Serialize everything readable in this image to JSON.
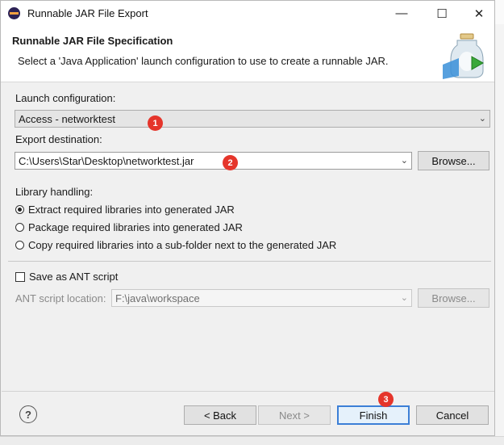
{
  "window": {
    "title": "Runnable JAR File Export",
    "controls": [
      "minimize-icon",
      "maximize-icon",
      "close-icon"
    ]
  },
  "header": {
    "title": "Runnable JAR File Specification",
    "description": "Select a 'Java Application' launch configuration to use to create a runnable JAR."
  },
  "launch": {
    "label": "Launch configuration:",
    "value": "Access - networktest",
    "badge": "1"
  },
  "export": {
    "label": "Export destination:",
    "value": "C:\\Users\\Star\\Desktop\\networktest.jar",
    "badge": "2",
    "browse_label": "Browse..."
  },
  "library": {
    "label": "Library handling:",
    "options": [
      {
        "label": "Extract required libraries into generated JAR",
        "selected": true
      },
      {
        "label": "Package required libraries into generated JAR",
        "selected": false
      },
      {
        "label": "Copy required libraries into a sub-folder next to the generated JAR",
        "selected": false
      }
    ]
  },
  "ant": {
    "checkbox_label": "Save as ANT script",
    "checked": false,
    "location_label": "ANT script location:",
    "location_value": "F:\\java\\workspace",
    "browse_label": "Browse..."
  },
  "footer": {
    "help": "?",
    "back_label": "< Back",
    "next_label": "Next >",
    "finish_label": "Finish",
    "cancel_label": "Cancel",
    "badge": "3"
  },
  "colors": {
    "badge": "#e5352b",
    "default_button_border": "#3c7fd6",
    "dialog_bg": "#f0f0f0"
  }
}
